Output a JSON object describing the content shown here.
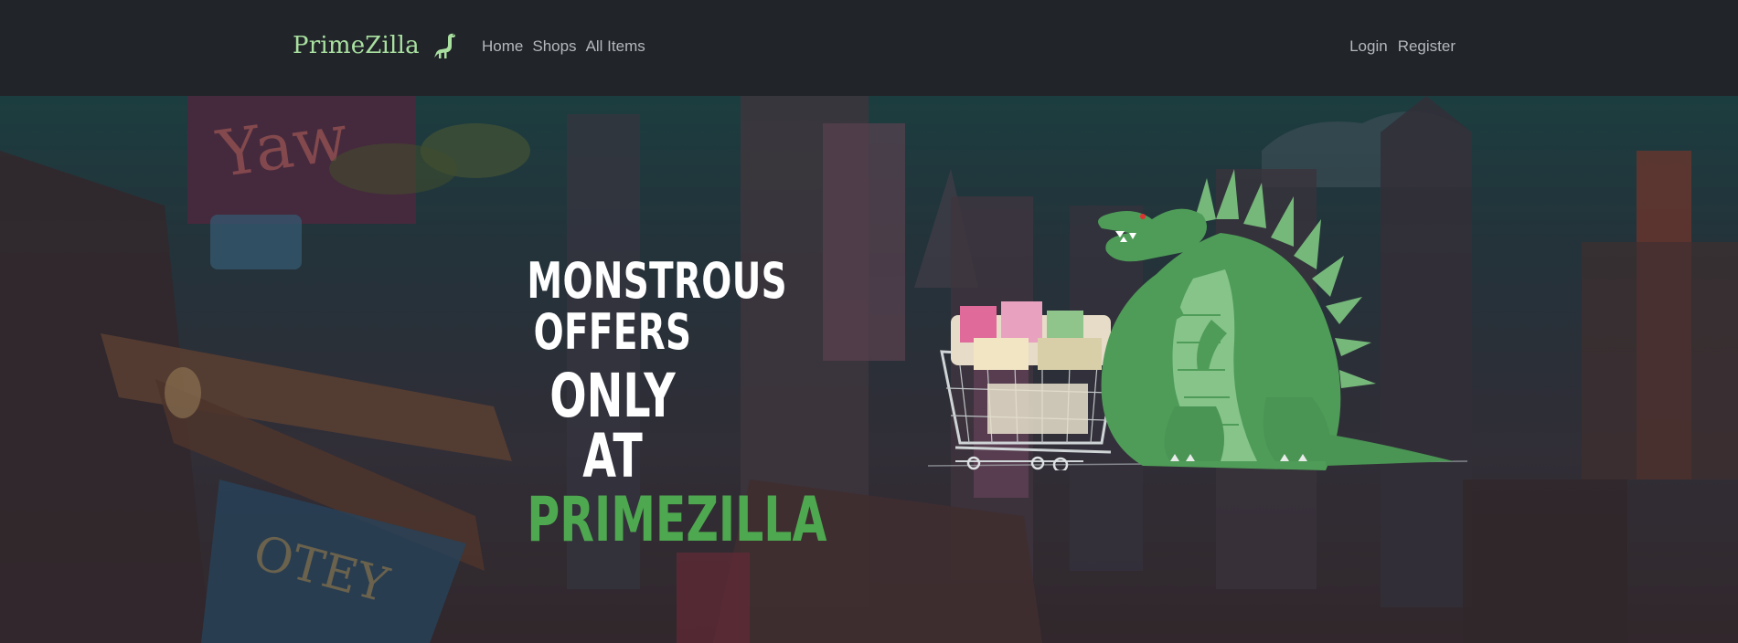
{
  "nav": {
    "brand": "PrimeZilla",
    "links_left": [
      {
        "label": "Home",
        "name": "nav-home-link"
      },
      {
        "label": "Shops",
        "name": "nav-shops-link"
      },
      {
        "label": "All Items",
        "name": "nav-all-items-link"
      }
    ],
    "links_right": [
      {
        "label": "Login",
        "name": "nav-login-link"
      },
      {
        "label": "Register",
        "name": "nav-register-link"
      }
    ]
  },
  "hero": {
    "line1": "MONSTROUS",
    "line2": "OFFERS",
    "line3": "ONLY AT",
    "line4": "PRIMEZILLA"
  },
  "colors": {
    "navbar_bg": "#212529",
    "brand": "#a9e0a0",
    "nav_link": "#b4b8bd",
    "accent_green": "#4ea84f",
    "headline_white": "#ffffff"
  },
  "icons": {
    "brand_logo": "dinosaur-logo-icon",
    "hero_art": "godzilla-with-shopping-cart-illustration"
  }
}
